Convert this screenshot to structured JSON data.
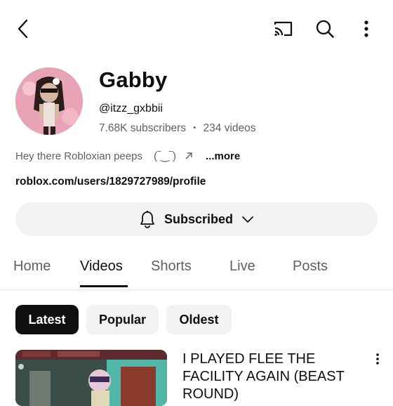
{
  "topbar": {
    "back_icon": "arrow-left-icon",
    "cast_icon": "cast-icon",
    "search_icon": "search-icon",
    "more_icon": "more-vert-icon"
  },
  "channel": {
    "name": "Gabby",
    "handle": "@itzz_gxbbii",
    "subscribers": "7.68K subscribers",
    "separator": "•",
    "videos": "234 videos",
    "description": "Hey there Robloxian peeps",
    "description_emote": "(‾‿‾)",
    "more_label": "...more",
    "link": "roblox.com/users/1829727989/profile"
  },
  "subscribe": {
    "label": "Subscribed",
    "bell_icon": "bell-icon",
    "chevron_icon": "chevron-down-icon"
  },
  "tabs": [
    {
      "label": "Home"
    },
    {
      "label": "Videos",
      "active": true
    },
    {
      "label": "Shorts"
    },
    {
      "label": "Live"
    },
    {
      "label": "Posts"
    }
  ],
  "chips": [
    {
      "label": "Latest",
      "selected": true
    },
    {
      "label": "Popular"
    },
    {
      "label": "Oldest"
    }
  ],
  "videos": [
    {
      "title": "I PLAYED FLEE THE FACILITY AGAIN (BEAST ROUND)"
    }
  ],
  "colors": {
    "text": "#0f0f0f",
    "secondary_text": "#606060",
    "chip_bg": "#f2f2f2",
    "chip_selected_bg": "#0f0f0f",
    "avatar_bg": "#e8a0b0"
  }
}
